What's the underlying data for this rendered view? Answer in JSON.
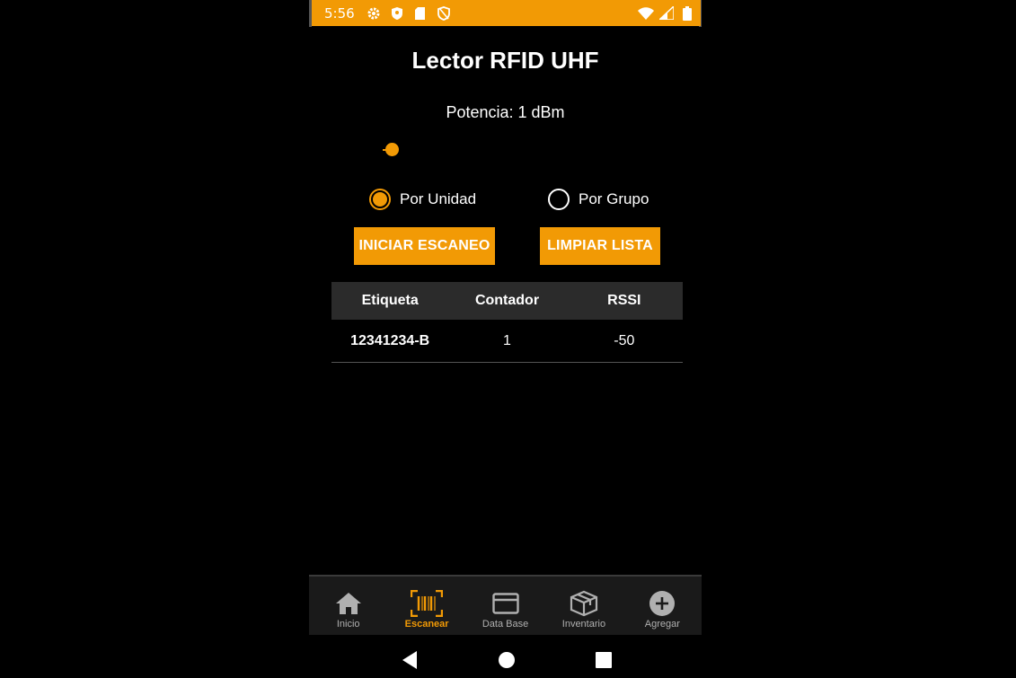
{
  "status_bar": {
    "time": "5:56",
    "left_icons": [
      "gear-icon",
      "shield-icon",
      "sd-card-icon",
      "privacy-icon"
    ],
    "right_icons": [
      "wifi-icon",
      "signal-icon",
      "battery-icon"
    ]
  },
  "header": {
    "title": "Lector RFID UHF"
  },
  "power": {
    "label": "Potencia: 1 dBm",
    "slider_fraction": 0
  },
  "mode": {
    "options": [
      {
        "label": "Por Unidad",
        "selected": true
      },
      {
        "label": "Por Grupo",
        "selected": false
      }
    ]
  },
  "actions": {
    "start_label": "INICIAR ESCANEO",
    "clear_label": "LIMPIAR LISTA"
  },
  "table": {
    "headers": [
      "Etiqueta",
      "Contador",
      "RSSI"
    ],
    "rows": [
      [
        "12341234-B",
        "1",
        "-50"
      ]
    ]
  },
  "bottom_nav": {
    "items": [
      {
        "label": "Inicio",
        "icon": "home-icon",
        "active": false
      },
      {
        "label": "Escanear",
        "icon": "barcode-scan-icon",
        "active": true
      },
      {
        "label": "Data Base",
        "icon": "card-icon",
        "active": false
      },
      {
        "label": "Inventario",
        "icon": "box-icon",
        "active": false
      },
      {
        "label": "Agregar",
        "icon": "add-circle-icon",
        "active": false
      }
    ]
  },
  "colors": {
    "accent": "#f29a05",
    "background": "#000000",
    "table_header": "#2b2b2b"
  }
}
